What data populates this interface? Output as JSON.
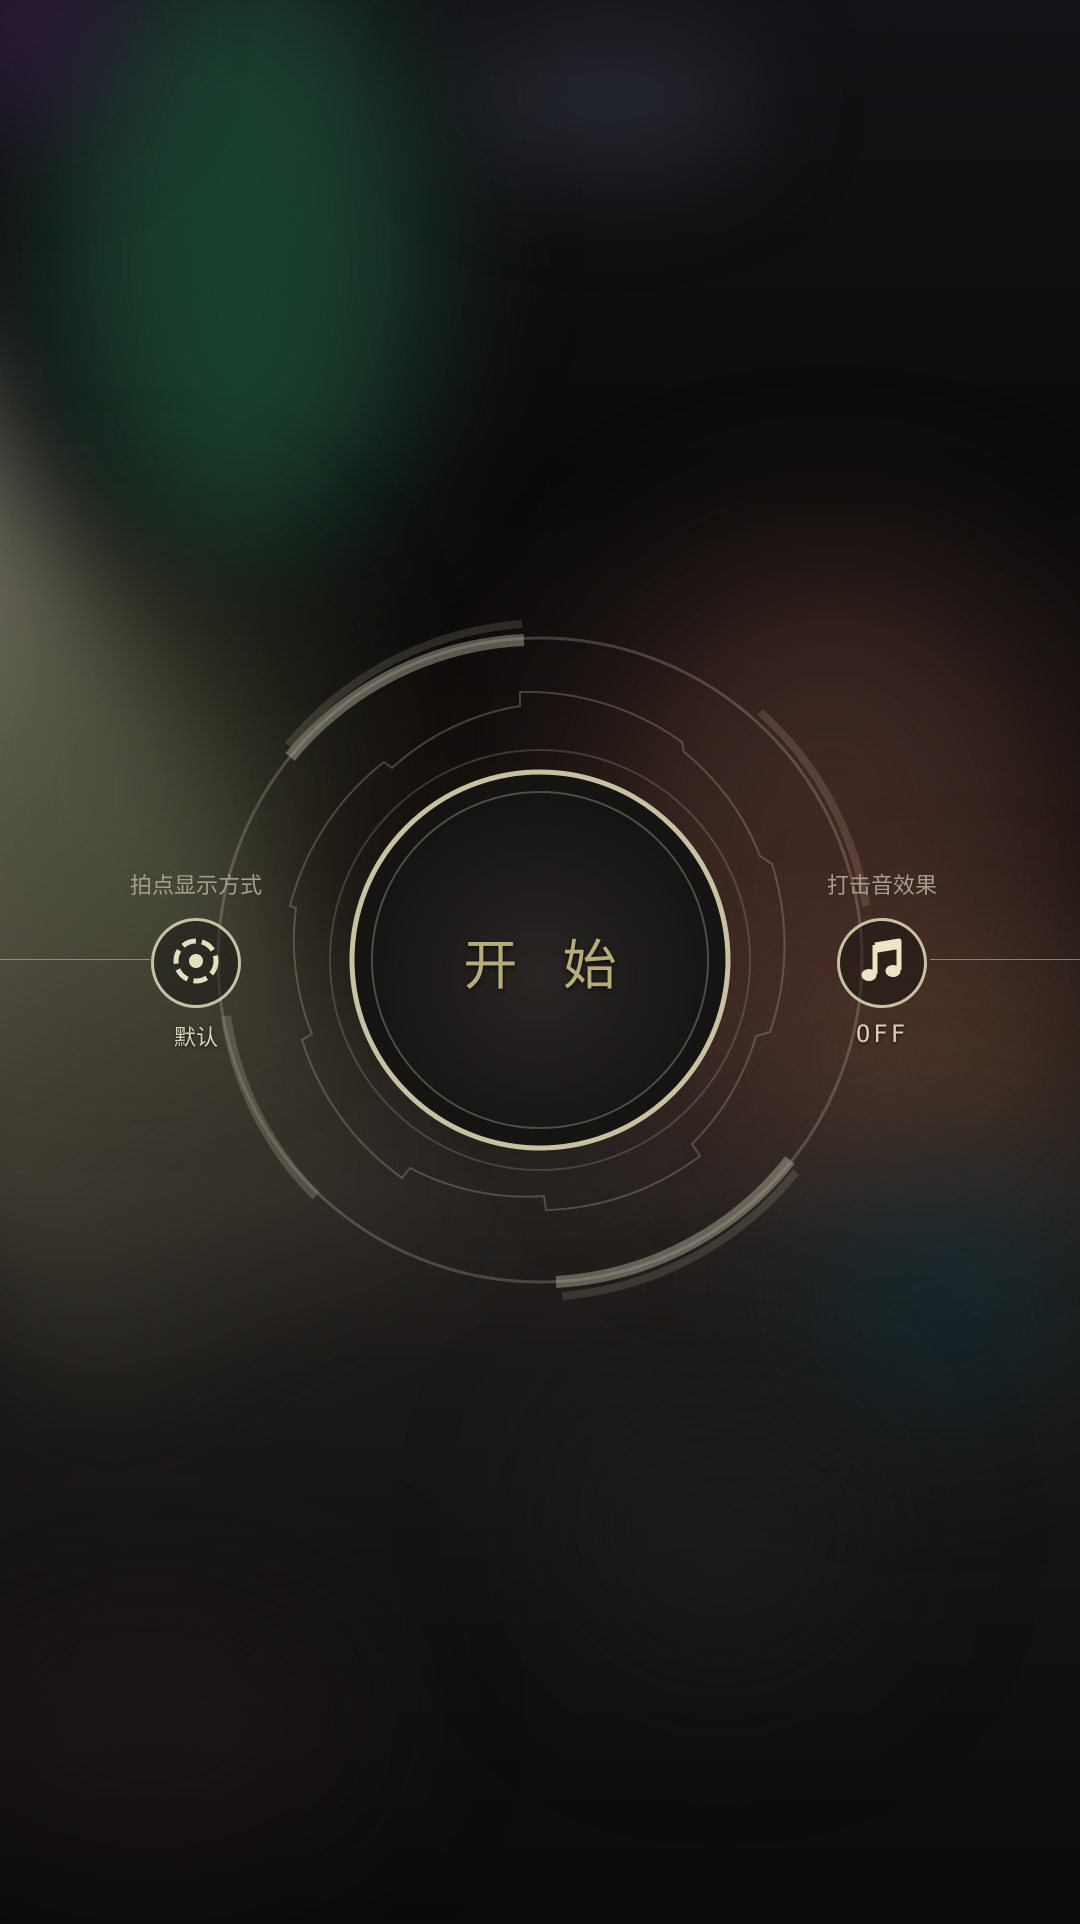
{
  "start": {
    "label": "开 始"
  },
  "beat_display": {
    "title": "拍点显示方式",
    "value": "默认",
    "icon": "dashed-target-icon"
  },
  "hit_sound": {
    "title": "打击音效果",
    "value": "OFF",
    "icon": "music-note-icon"
  },
  "colors": {
    "accent_gold": "#b8ac7a",
    "ring": "#c8c1a2",
    "label_muted": "#a29d8d"
  }
}
